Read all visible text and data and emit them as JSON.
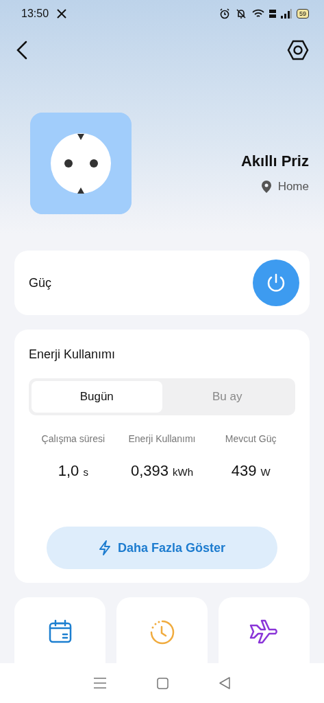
{
  "status_bar": {
    "time": "13:50",
    "battery": "59"
  },
  "device": {
    "name": "Akıllı Priz",
    "location": "Home"
  },
  "power": {
    "label": "Güç",
    "on": true
  },
  "energy": {
    "title": "Enerji Kullanımı",
    "tabs": [
      {
        "label": "Bugün",
        "selected": true
      },
      {
        "label": "Bu ay",
        "selected": false
      }
    ],
    "stats": [
      {
        "label": "Çalışma süresi",
        "value": "1,0",
        "unit": "s"
      },
      {
        "label": "Enerji Kullanımı",
        "value": "0,393",
        "unit": "kWh"
      },
      {
        "label": "Mevcut Güç",
        "value": "439",
        "unit": "W"
      }
    ],
    "more_button": "Daha Fazla Göster"
  },
  "tiles": [
    {
      "kind": "calendar"
    },
    {
      "kind": "clock"
    },
    {
      "kind": "plane"
    }
  ]
}
